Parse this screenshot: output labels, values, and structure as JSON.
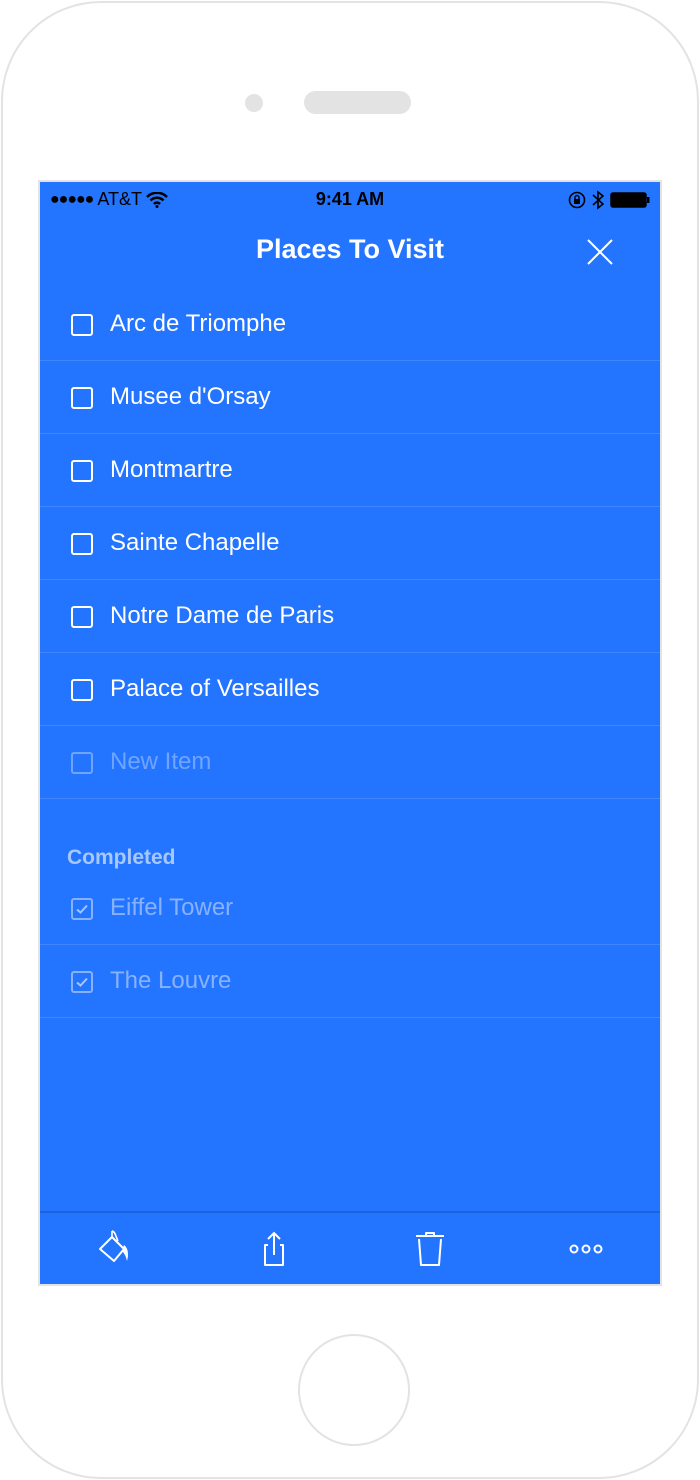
{
  "status_bar": {
    "carrier": "AT&T",
    "time": "9:41 AM"
  },
  "header": {
    "title": "Places To Visit",
    "close_icon": "close-icon"
  },
  "todo_items": [
    {
      "label": "Arc de Triomphe",
      "checked": false
    },
    {
      "label": "Musee d'Orsay",
      "checked": false
    },
    {
      "label": "Montmartre",
      "checked": false
    },
    {
      "label": "Sainte Chapelle",
      "checked": false
    },
    {
      "label": "Notre Dame de Paris",
      "checked": false
    },
    {
      "label": "Palace of Versailles",
      "checked": false
    }
  ],
  "new_item": {
    "placeholder": "New Item"
  },
  "completed": {
    "heading": "Completed",
    "items": [
      {
        "label": "Eiffel Tower",
        "checked": true
      },
      {
        "label": "The Louvre",
        "checked": true
      }
    ]
  },
  "toolbar": {
    "icons": [
      "paint-bucket-icon",
      "share-icon",
      "trash-icon",
      "more-icon"
    ]
  },
  "colors": {
    "background": "#2374FF",
    "text": "#FFFFFF"
  }
}
